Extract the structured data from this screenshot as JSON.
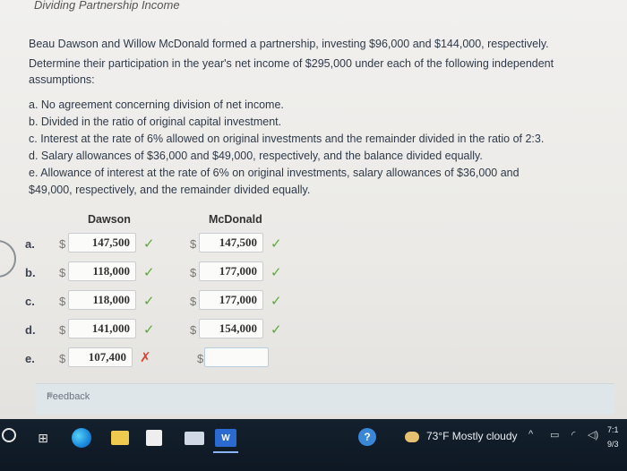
{
  "page": {
    "title": "Dividing Partnership Income",
    "intro": "Beau Dawson and Willow McDonald formed a partnership, investing $96,000 and $144,000, respectively.",
    "prompt": "Determine their participation in the year's net income of $295,000 under each of the following independent assumptions:",
    "options": [
      "a. No agreement concerning division of net income.",
      "b. Divided in the ratio of original capital investment.",
      "c. Interest at the rate of 6% allowed on original investments and the remainder divided in the ratio of 2:3.",
      "d. Salary allowances of $36,000 and $49,000, respectively, and the balance divided equally.",
      "e. Allowance of interest at the rate of 6% on original investments, salary allowances of $36,000 and"
    ],
    "option_e_continued": "$49,000, respectively, and the remainder divided equally."
  },
  "table": {
    "col_dawson": "Dawson",
    "col_mcdonald": "McDonald",
    "currency": "$",
    "rows": [
      {
        "label": "a.",
        "dawson": "147,500",
        "dawson_status": "correct",
        "mcdonald": "147,500",
        "mcdonald_status": "correct"
      },
      {
        "label": "b.",
        "dawson": "118,000",
        "dawson_status": "correct",
        "mcdonald": "177,000",
        "mcdonald_status": "correct"
      },
      {
        "label": "c.",
        "dawson": "118,000",
        "dawson_status": "correct",
        "mcdonald": "177,000",
        "mcdonald_status": "correct"
      },
      {
        "label": "d.",
        "dawson": "141,000",
        "dawson_status": "correct",
        "mcdonald": "154,000",
        "mcdonald_status": "correct"
      },
      {
        "label": "e.",
        "dawson": "107,400",
        "dawson_status": "incorrect",
        "mcdonald": "",
        "mcdonald_status": "none"
      }
    ],
    "marks": {
      "correct": "✓",
      "incorrect": "✗"
    }
  },
  "feedback": {
    "label": "Feedback"
  },
  "taskbar": {
    "word_label": "W",
    "help_label": "?",
    "weather": "73°F  Mostly cloudy",
    "clock_time": "7:1",
    "clock_date": "9/3"
  },
  "colors": {
    "correct": "#5ea83a",
    "incorrect": "#d9432f"
  }
}
